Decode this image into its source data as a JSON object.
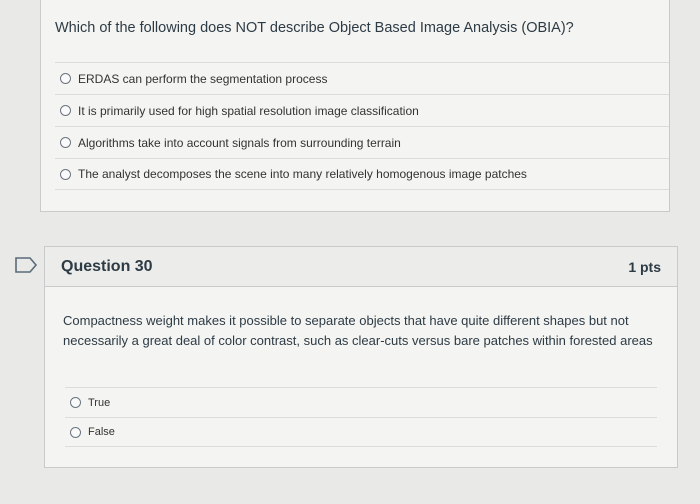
{
  "question29": {
    "text": "Which of the following does NOT describe Object Based Image Analysis (OBIA)?",
    "answers": [
      "ERDAS can perform the segmentation process",
      "It is primarily used for high spatial resolution image classification",
      "Algorithms take into account signals from surrounding terrain",
      "The analyst decomposes the scene into many relatively homogenous image patches"
    ]
  },
  "question30": {
    "title": "Question 30",
    "points": "1 pts",
    "text": "Compactness weight makes it possible to separate objects that have quite different shapes but not necessarily a great deal of color contrast, such as clear-cuts versus bare patches within forested areas",
    "answers": [
      "True",
      "False"
    ]
  },
  "colors": {
    "background": "#e9e9e7",
    "card": "#f4f4f2",
    "border": "#c9cacb",
    "text": "#2d3b45"
  }
}
